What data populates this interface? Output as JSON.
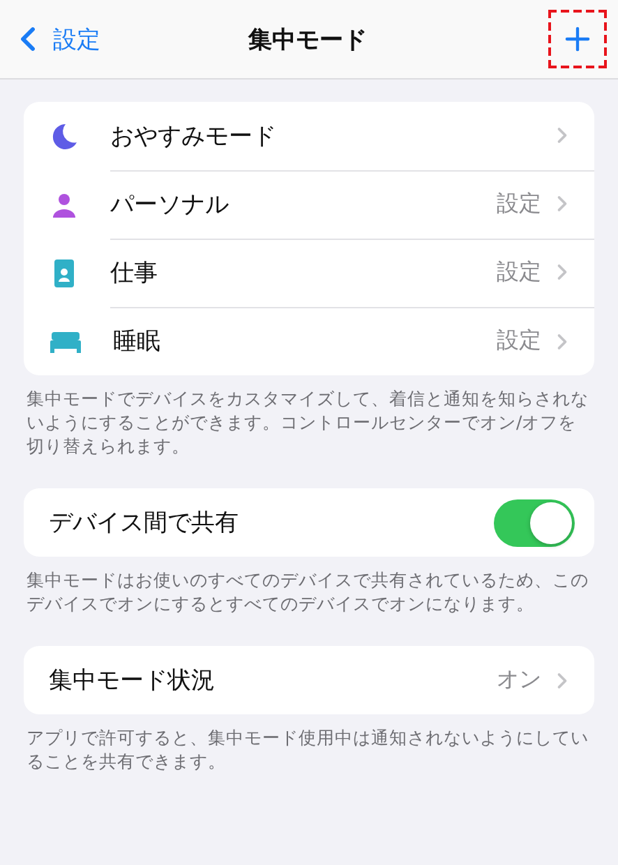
{
  "nav": {
    "back": "設定",
    "title": "集中モード",
    "highlight_add": true
  },
  "focus_modes": [
    {
      "kind": "moon",
      "label": "おやすみモード"
    },
    {
      "kind": "person",
      "label": "パーソナル",
      "detail": "設定"
    },
    {
      "kind": "badge",
      "label": "仕事",
      "detail": "設定"
    },
    {
      "kind": "bed",
      "label": "睡眠",
      "detail": "設定"
    }
  ],
  "focus_note": "集中モードでデバイスをカスタマイズして、着信と通知を知らされないようにすることができます。コントロールセンターでオン/オフを切り替えられます。",
  "share": {
    "label": "デバイス間で共有",
    "on": true
  },
  "share_note": "集中モードはお使いのすべてのデバイスで共有されているため、このデバイスでオンにするとすべてのデバイスでオンになります。",
  "status": {
    "label": "集中モード状況",
    "value": "オン"
  },
  "status_note": "アプリで許可すると、集中モード使用中は通知されないようにしていることを共有できます。"
}
